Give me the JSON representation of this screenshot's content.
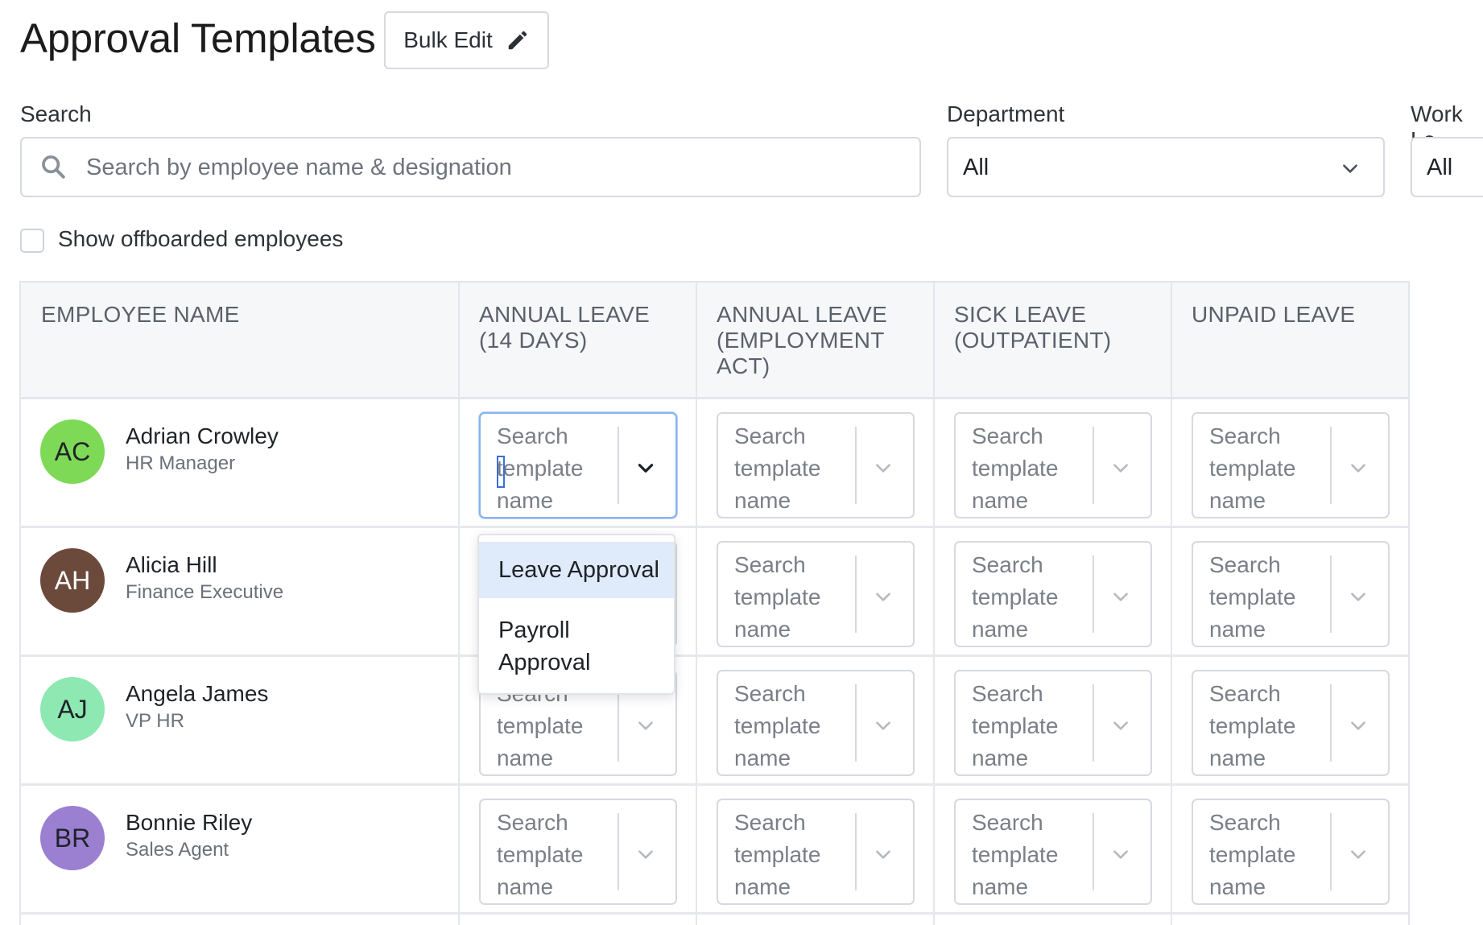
{
  "page_title": "Approval Templates",
  "bulk_edit": {
    "label": "Bulk Edit",
    "icon": "pencil-icon"
  },
  "filters": {
    "search": {
      "label": "Search",
      "placeholder": "Search by employee name & designation",
      "icon": "search-icon"
    },
    "department": {
      "label": "Department",
      "value": "All"
    },
    "work_location": {
      "label": "Work Lo",
      "value": "All"
    }
  },
  "offboarded": {
    "label": "Show offboarded employees",
    "checked": false
  },
  "table": {
    "columns": [
      {
        "line1": "EMPLOYEE NAME",
        "line2": "",
        "line3": ""
      },
      {
        "line1": "ANNUAL LEAVE",
        "line2": "(14 DAYS)",
        "line3": ""
      },
      {
        "line1": "ANNUAL LEAVE",
        "line2": "(EMPLOYMENT",
        "line3": "ACT)"
      },
      {
        "line1": "SICK LEAVE",
        "line2": "(OUTPATIENT)",
        "line3": ""
      },
      {
        "line1": "UNPAID LEAVE",
        "line2": "",
        "line3": ""
      }
    ],
    "template_placeholder": "Search template name",
    "rows": [
      {
        "initials": "AC",
        "name": "Adrian Crowley",
        "title": "HR Manager",
        "avatar_color": "#7ed957",
        "initials_color": "#1f2328"
      },
      {
        "initials": "AH",
        "name": "Alicia Hill",
        "title": "Finance Executive",
        "avatar_color": "#6b4a3c",
        "initials_color": "#ffffff"
      },
      {
        "initials": "AJ",
        "name": "Angela James",
        "title": "VP HR",
        "avatar_color": "#8ee8b2",
        "initials_color": "#1f2328"
      },
      {
        "initials": "BR",
        "name": "Bonnie Riley",
        "title": "Sales Agent",
        "avatar_color": "#9b7fd1",
        "initials_color": "#1f2328"
      }
    ]
  },
  "dropdown": {
    "options": [
      {
        "label": "Leave Approval",
        "highlighted": true
      },
      {
        "label_line1": "Payroll",
        "label_line2": "Approval",
        "highlighted": false
      }
    ]
  },
  "colors": {
    "focus_border": "#8ab3ef",
    "highlight_bg": "#dfeafb"
  }
}
